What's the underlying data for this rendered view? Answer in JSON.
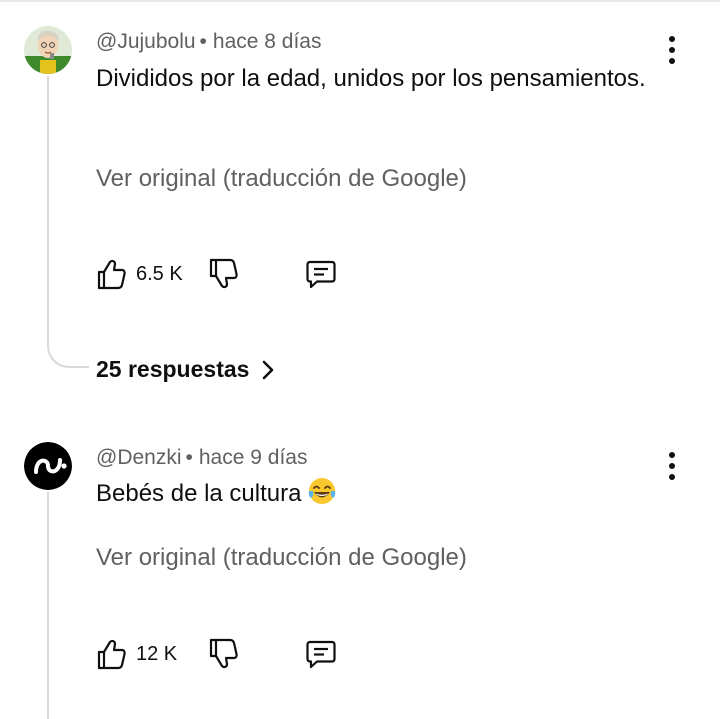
{
  "comments": [
    {
      "author": "@Jujubolu",
      "separator": "•",
      "time": "hace 8 días",
      "text": "Divididos por la edad, unidos por los pensamientos.",
      "translate_link": "Ver original (traducción de Google)",
      "likes": "6.5 K",
      "replies_label": "25 respuestas"
    },
    {
      "author": "@Denzki",
      "separator": "•",
      "time": "hace 9 días",
      "text": "Bebés de la cultura",
      "emoji": "😂",
      "translate_link": "Ver original (traducción de Google)",
      "likes": "12 K"
    }
  ],
  "icons": {
    "like": "thumbs-up-icon",
    "dislike": "thumbs-down-icon",
    "reply": "comment-icon",
    "menu": "more-vert-icon",
    "chevron": "chevron-right-icon"
  },
  "colors": {
    "text": "#0f0f0f",
    "secondary": "#606060",
    "thread": "#d9d9d9"
  }
}
